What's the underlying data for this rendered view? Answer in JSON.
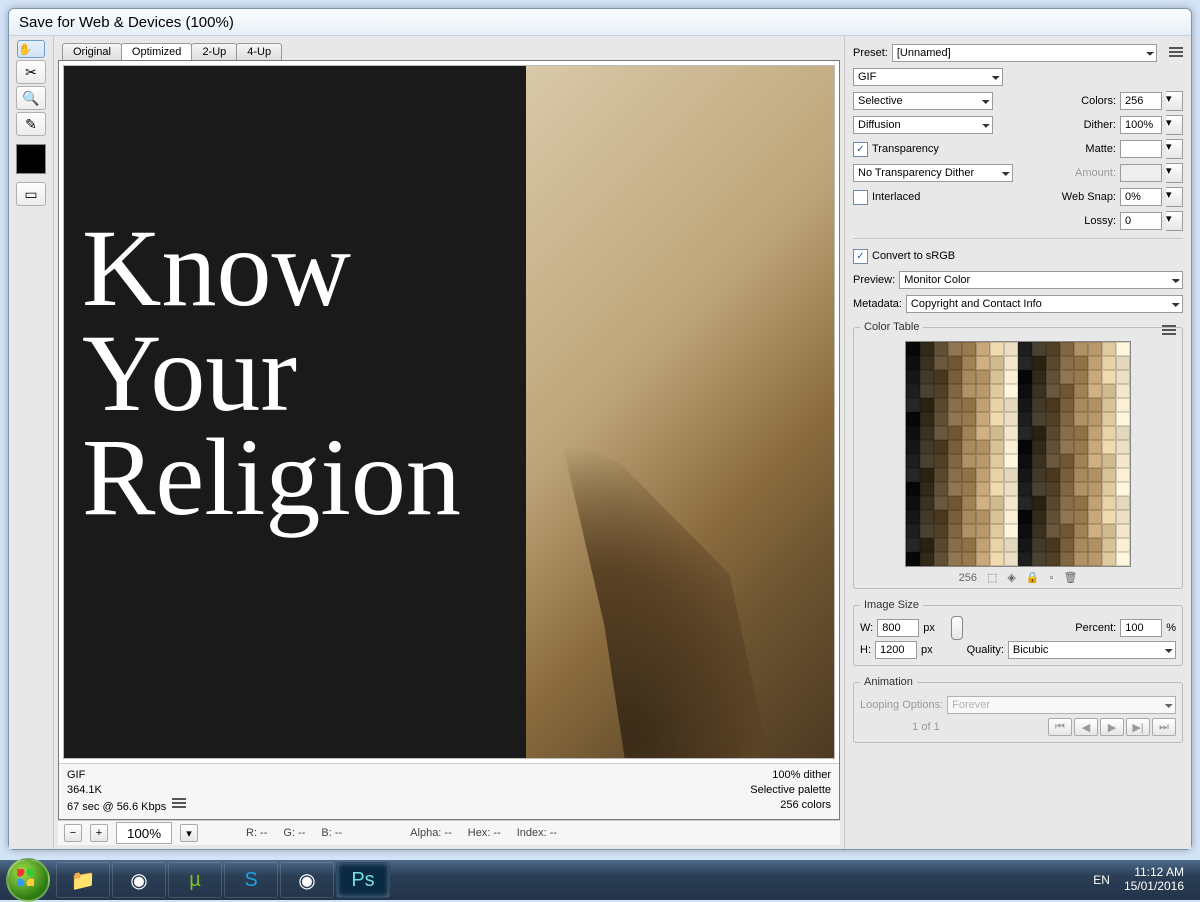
{
  "title": "Save for Web & Devices (100%)",
  "tabs": {
    "original": "Original",
    "optimized": "Optimized",
    "two_up": "2-Up",
    "four_up": "4-Up"
  },
  "artwork": {
    "line1": "Know",
    "line2": "Your",
    "line3": "Religion"
  },
  "info_left": {
    "format": "GIF",
    "size": "364.1K",
    "time": "67 sec @ 56.6 Kbps"
  },
  "info_right": {
    "dither": "100% dither",
    "palette": "Selective palette",
    "colors": "256 colors"
  },
  "bottom": {
    "zoom": "100%",
    "r": "R: --",
    "g": "G: --",
    "b": "B: --",
    "alpha": "Alpha: --",
    "hex": "Hex: --",
    "index": "Index: --"
  },
  "settings": {
    "preset_label": "Preset:",
    "preset_value": "[Unnamed]",
    "format": "GIF",
    "reduction": "Selective",
    "colors_label": "Colors:",
    "colors_value": "256",
    "dither_algo": "Diffusion",
    "dither_label": "Dither:",
    "dither_value": "100%",
    "transparency_label": "Transparency",
    "matte_label": "Matte:",
    "trans_dither": "No Transparency Dither",
    "amount_label": "Amount:",
    "interlaced_label": "Interlaced",
    "websnap_label": "Web Snap:",
    "websnap_value": "0%",
    "lossy_label": "Lossy:",
    "lossy_value": "0",
    "srgb_label": "Convert to sRGB",
    "preview_label": "Preview:",
    "preview_value": "Monitor Color",
    "metadata_label": "Metadata:",
    "metadata_value": "Copyright and Contact Info",
    "colortable_label": "Color Table",
    "colortable_count": "256",
    "imagesize_label": "Image Size",
    "w_label": "W:",
    "w_value": "800",
    "h_label": "H:",
    "h_value": "1200",
    "px": "px",
    "percent_label": "Percent:",
    "percent_value": "100",
    "pct": "%",
    "quality_label": "Quality:",
    "quality_value": "Bicubic",
    "animation_label": "Animation",
    "loop_label": "Looping Options:",
    "loop_value": "Forever",
    "frame": "1 of 1"
  },
  "tray": {
    "lang": "EN",
    "time": "11:12 AM",
    "date": "15/01/2016"
  }
}
